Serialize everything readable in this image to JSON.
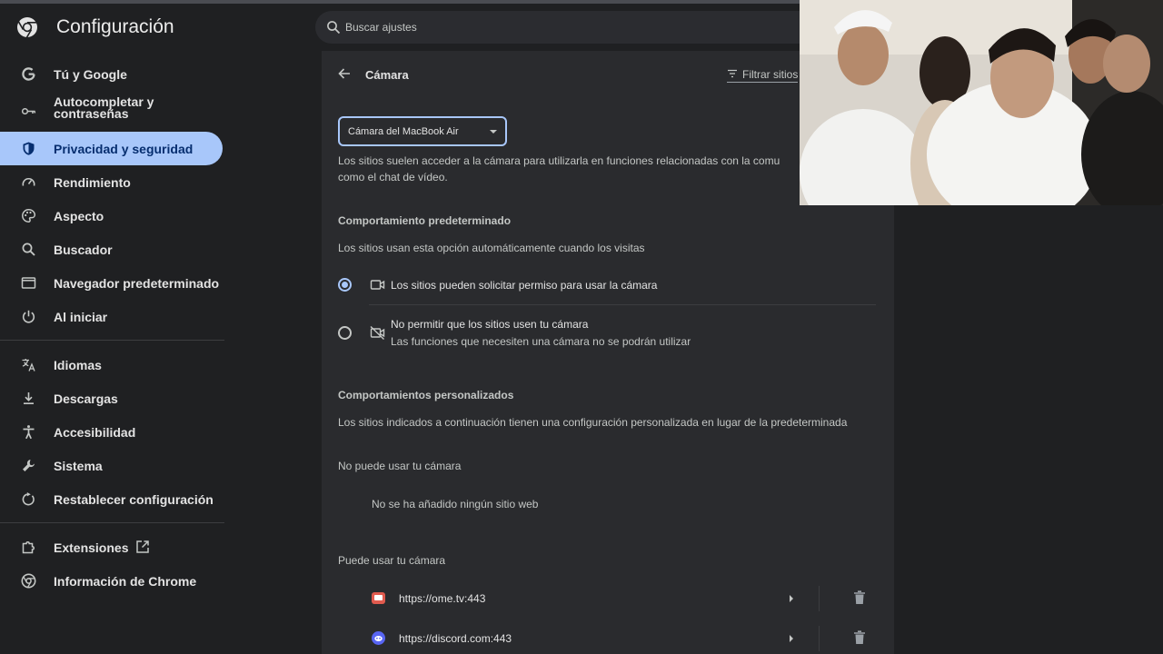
{
  "header": {
    "app_title": "Configuración",
    "search_placeholder": "Buscar ajustes"
  },
  "sidebar": {
    "items": [
      {
        "label": "Tú y Google",
        "icon": "google-g-icon"
      },
      {
        "label": "Autocompletar y contraseñas",
        "icon": "key-icon"
      },
      {
        "label": "Privacidad y seguridad",
        "icon": "shield-icon",
        "active": true
      },
      {
        "label": "Rendimiento",
        "icon": "speedometer-icon"
      },
      {
        "label": "Aspecto",
        "icon": "palette-icon"
      },
      {
        "label": "Buscador",
        "icon": "search-icon"
      },
      {
        "label": "Navegador predeterminado",
        "icon": "browser-window-icon"
      },
      {
        "label": "Al iniciar",
        "icon": "power-icon"
      },
      {
        "label": "Idiomas",
        "icon": "translate-icon"
      },
      {
        "label": "Descargas",
        "icon": "download-icon"
      },
      {
        "label": "Accesibilidad",
        "icon": "accessibility-icon"
      },
      {
        "label": "Sistema",
        "icon": "wrench-icon"
      },
      {
        "label": "Restablecer configuración",
        "icon": "reset-icon"
      },
      {
        "label": "Extensiones",
        "icon": "puzzle-icon"
      },
      {
        "label": "Información de Chrome",
        "icon": "chrome-icon"
      }
    ]
  },
  "main": {
    "title": "Cámara",
    "filter_label": "Filtrar sitios",
    "camera_select_value": "Cámara del MacBook Air",
    "intro_line1": "Los sitios suelen acceder a la cámara para utilizarla en funciones relacionadas con la comu",
    "intro_line2": "como el chat de vídeo.",
    "default_heading": "Comportamiento predeterminado",
    "default_desc": "Los sitios usan esta opción automáticamente cuando los visitas",
    "option_allow": "Los sitios pueden solicitar permiso para usar la cámara",
    "option_block": "No permitir que los sitios usen tu cámara",
    "option_block_sub": "Las funciones que necesiten una cámara no se podrán utilizar",
    "custom_heading": "Comportamientos personalizados",
    "custom_desc": "Los sitios indicados a continuación tienen una configuración personalizada en lugar de la predeterminada",
    "blocked_heading": "No puede usar tu cámara",
    "blocked_empty": "No se ha añadido ningún sitio web",
    "allowed_heading": "Puede usar tu cámara",
    "allowed_sites": [
      {
        "url": "https://ome.tv:443",
        "favicon_color": "#e05a4e"
      },
      {
        "url": "https://discord.com:443",
        "favicon_color": "#5865f2"
      }
    ]
  }
}
